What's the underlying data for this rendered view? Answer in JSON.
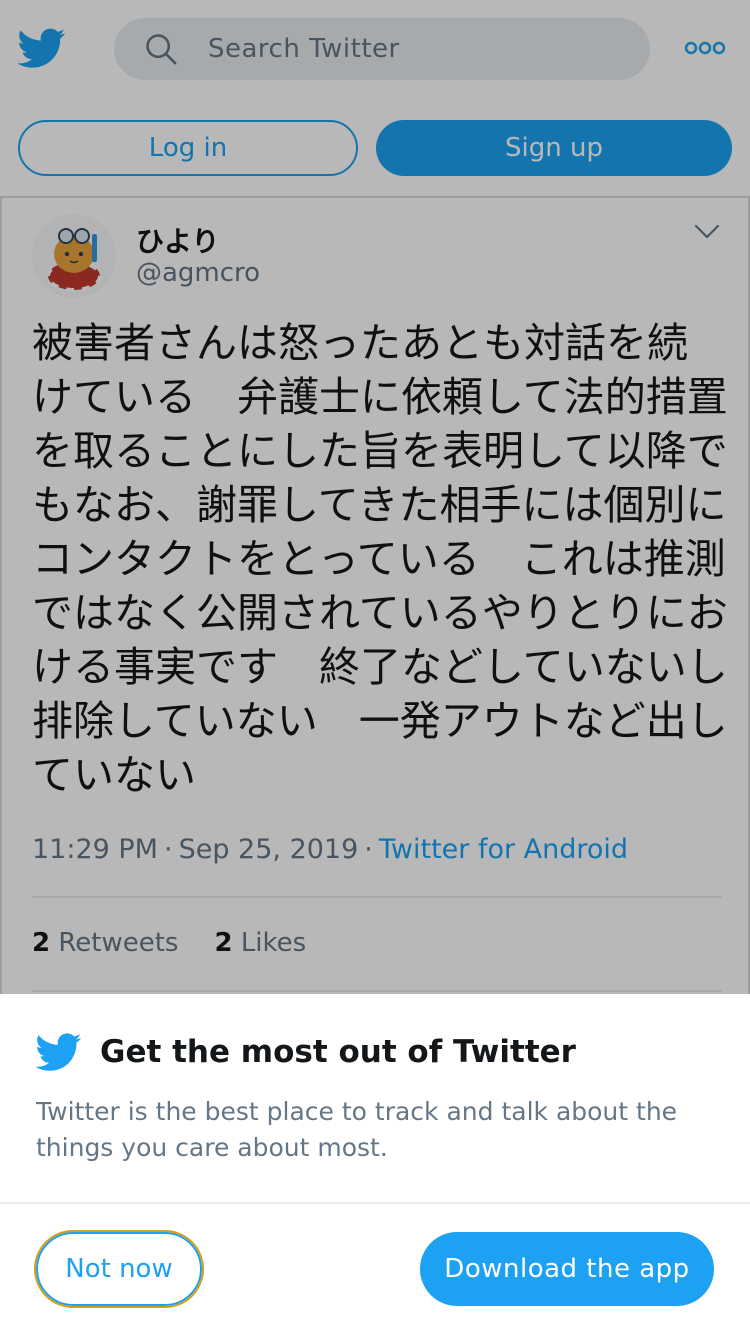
{
  "header": {
    "search_placeholder": "Search Twitter",
    "login_label": "Log in",
    "signup_label": "Sign up",
    "logo_icon": "twitter-bird-icon",
    "more_icon": "more-options-icon"
  },
  "tweet": {
    "display_name": "ひより",
    "handle": "@agmcro",
    "text": "被害者さんは怒ったあとも対話を続けている　弁護士に依頼して法的措置を取ることにした旨を表明して以降でもなお、謝罪してきた相手には個別にコンタクトをとっている　これは推測ではなく公開されているやりとりにおける事実です　終了などしていないし排除していない　一発アウトなど出していない",
    "time": "11:29 PM",
    "date": "Sep 25, 2019",
    "source": "Twitter for Android",
    "retweets_count": "2",
    "retweets_label": "Retweets",
    "likes_count": "2",
    "likes_label": "Likes"
  },
  "sheet": {
    "title": "Get the most out of Twitter",
    "body": "Twitter is the best place to track and talk about the things you care about most.",
    "not_now_label": "Not now",
    "download_label": "Download the app"
  },
  "colors": {
    "brand": "#1da1f2",
    "text_primary": "#14171a",
    "text_secondary": "#657786"
  }
}
